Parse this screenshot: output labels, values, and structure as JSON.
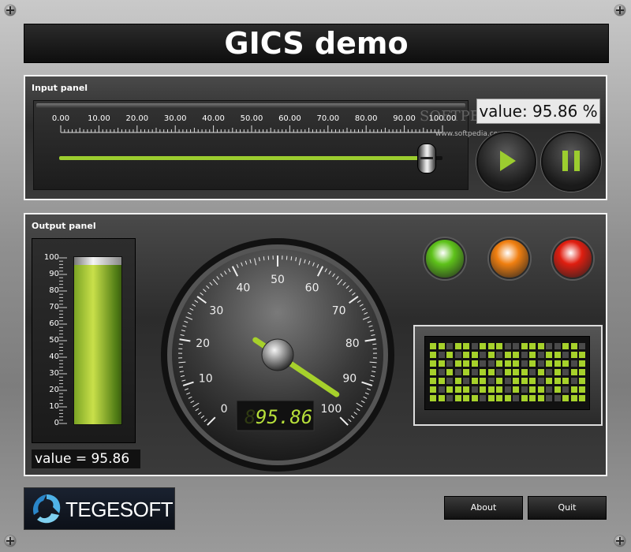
{
  "app": {
    "title": "GICS demo"
  },
  "input_panel": {
    "label": "Input panel",
    "slider_ticks": [
      "0.00",
      "10.00",
      "20.00",
      "30.00",
      "40.00",
      "50.00",
      "60.00",
      "70.00",
      "80.00",
      "90.00",
      "100.00"
    ],
    "slider_value": 95.86,
    "value_display": "value: 95.86 %",
    "watermark_big": "SOFTPEDIA",
    "watermark_small": "www.softpedia.com",
    "play_icon": "play-icon",
    "pause_icon": "pause-icon"
  },
  "output_panel": {
    "label": "Output panel",
    "tank_ticks": [
      "100",
      "90",
      "80",
      "70",
      "60",
      "50",
      "40",
      "30",
      "20",
      "10",
      "0"
    ],
    "tank_level": 95.86,
    "tank_value": "value = 95.86",
    "gauge_ticks": [
      "0",
      "10",
      "20",
      "30",
      "40",
      "50",
      "60",
      "70",
      "80",
      "90",
      "100"
    ],
    "gauge_value": 95.86,
    "gauge_readout": "95.86",
    "gauge_ghost_digit": "8",
    "lamps": [
      {
        "name": "green-lamp",
        "color": "#5ec21a"
      },
      {
        "name": "orange-lamp",
        "color": "#f07f10"
      },
      {
        "name": "red-lamp",
        "color": "#e01e10"
      }
    ],
    "matrix_colors": {
      "on": "#a6d12b",
      "off": "#4a4a4a"
    }
  },
  "footer": {
    "logo_text": "TEGESOFT",
    "about_label": "About",
    "quit_label": "Quit"
  }
}
